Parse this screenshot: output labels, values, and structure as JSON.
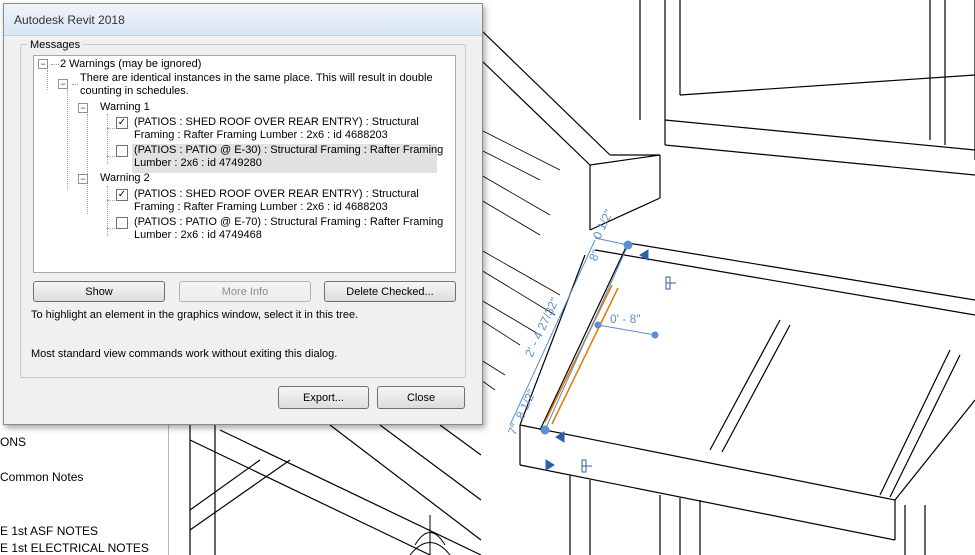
{
  "dialog": {
    "title": "Autodesk Revit 2018",
    "group_label": "Messages",
    "tree": {
      "root": "2 Warnings (may be ignored)",
      "description_line1": "There are identical instances in the same place. This will result in double",
      "description_line2": "counting in schedules.",
      "warnings": [
        {
          "label": "Warning 1",
          "items": [
            {
              "checked": true,
              "line1": "(PATIOS : SHED ROOF OVER REAR ENTRY) : Structural",
              "line2": "Framing : Rafter Framing Lumber : 2x6 : id 4688203"
            },
            {
              "checked": false,
              "line1": "(PATIOS : PATIO @ E-30) : Structural Framing : Rafter Framing",
              "line2": "Lumber : 2x6 : id 4749280"
            }
          ]
        },
        {
          "label": "Warning 2",
          "items": [
            {
              "checked": true,
              "line1": "(PATIOS : SHED ROOF OVER REAR ENTRY) : Structural",
              "line2": "Framing : Rafter Framing Lumber : 2x6 : id 4688203"
            },
            {
              "checked": false,
              "line1": "(PATIOS : PATIO @ E-70) : Structural Framing : Rafter Framing",
              "line2": "Lumber : 2x6 : id 4749468"
            }
          ]
        }
      ]
    },
    "buttons": {
      "show": "Show",
      "more_info": "More Info",
      "delete_checked": "Delete Checked...",
      "export": "Export...",
      "close": "Close"
    },
    "hint1": "To highlight an element in the graphics window, select it in this tree.",
    "hint2": "Most standard view commands work without exiting this dialog."
  },
  "browser_items": [
    "ONS",
    "Common Notes",
    "E 1st ASF NOTES",
    "E 1st ELECTRICAL NOTES"
  ],
  "dimensions": {
    "d1": "0 1/2\"",
    "d2": "8\"",
    "d3": "0' - 8\"",
    "d4": "2' - 4 27/32\"",
    "d5": "8 1/2\"",
    "d6": "7\""
  },
  "colors": {
    "dimension": "#5b8fd0",
    "framing_highlight": "#e07b00"
  }
}
